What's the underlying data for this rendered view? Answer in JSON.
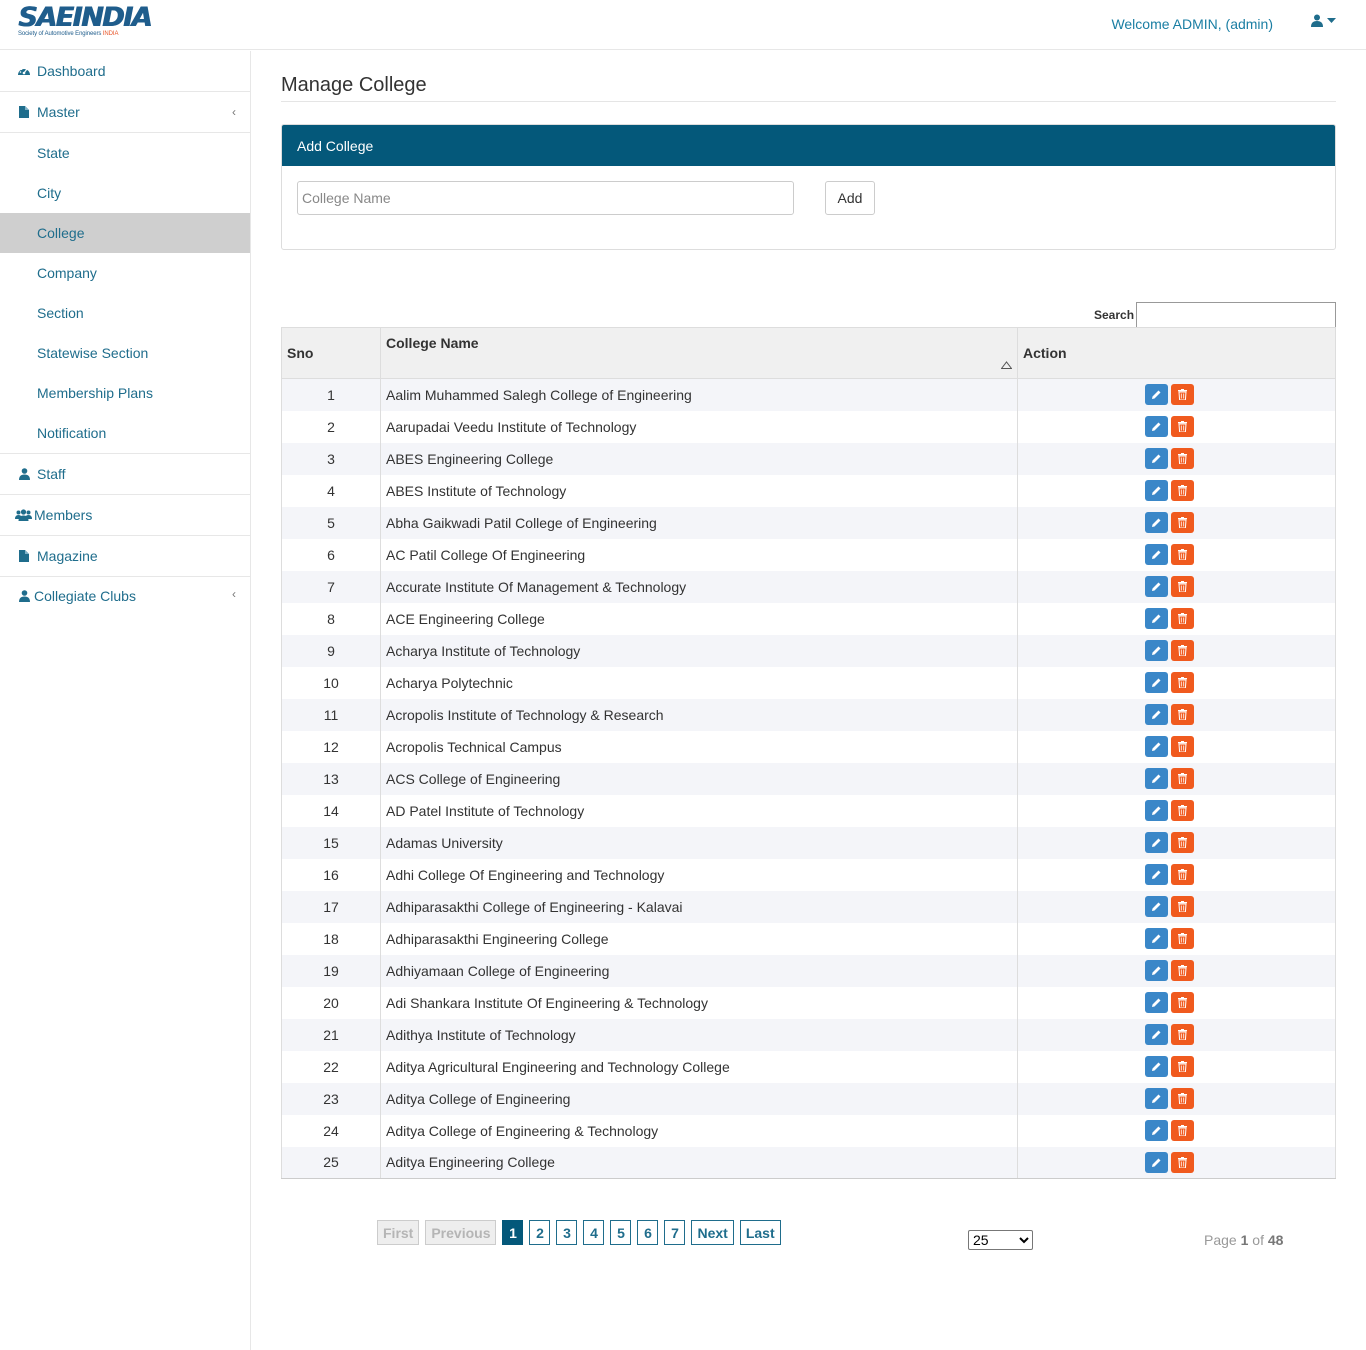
{
  "header": {
    "logo_text": "SAEINDIA",
    "logo_sub_prefix": "Society of Automotive Engineers ",
    "logo_sub_accent": "INDIA",
    "welcome": "Welcome ADMIN, (admin)"
  },
  "sidebar": {
    "dashboard": "Dashboard",
    "master": "Master",
    "master_items": [
      "State",
      "City",
      "College",
      "Company",
      "Section",
      "Statewise Section",
      "Membership Plans",
      "Notification"
    ],
    "active_item": "College",
    "staff": "Staff",
    "members": "Members",
    "magazine": "Magazine",
    "collegiate_clubs": "Collegiate Clubs"
  },
  "main": {
    "title": "Manage College",
    "panel_title": "Add College",
    "name_placeholder": "College Name",
    "add_label": "Add",
    "search_label": "Search",
    "columns": {
      "sno": "Sno",
      "name": "College Name",
      "action": "Action"
    },
    "rows": [
      {
        "sno": "1",
        "name": "Aalim Muhammed Salegh College of Engineering"
      },
      {
        "sno": "2",
        "name": "Aarupadai Veedu Institute of Technology"
      },
      {
        "sno": "3",
        "name": "ABES Engineering College"
      },
      {
        "sno": "4",
        "name": "ABES Institute of Technology"
      },
      {
        "sno": "5",
        "name": "Abha Gaikwadi Patil College of Engineering"
      },
      {
        "sno": "6",
        "name": "AC Patil College Of Engineering"
      },
      {
        "sno": "7",
        "name": "Accurate Institute Of Management & Technology"
      },
      {
        "sno": "8",
        "name": "ACE Engineering College"
      },
      {
        "sno": "9",
        "name": "Acharya Institute of Technology"
      },
      {
        "sno": "10",
        "name": "Acharya Polytechnic"
      },
      {
        "sno": "11",
        "name": "Acropolis Institute of Technology & Research"
      },
      {
        "sno": "12",
        "name": "Acropolis Technical Campus"
      },
      {
        "sno": "13",
        "name": "ACS College of Engineering"
      },
      {
        "sno": "14",
        "name": "AD Patel Institute of Technology"
      },
      {
        "sno": "15",
        "name": "Adamas University"
      },
      {
        "sno": "16",
        "name": "Adhi College Of Engineering and Technology"
      },
      {
        "sno": "17",
        "name": "Adhiparasakthi College of Engineering - Kalavai"
      },
      {
        "sno": "18",
        "name": "Adhiparasakthi Engineering College"
      },
      {
        "sno": "19",
        "name": "Adhiyamaan College of Engineering"
      },
      {
        "sno": "20",
        "name": "Adi Shankara Institute Of Engineering & Technology"
      },
      {
        "sno": "21",
        "name": "Adithya Institute of Technology"
      },
      {
        "sno": "22",
        "name": "Aditya Agricultural Engineering and Technology College"
      },
      {
        "sno": "23",
        "name": "Aditya College of Engineering"
      },
      {
        "sno": "24",
        "name": "Aditya College of Engineering & Technology"
      },
      {
        "sno": "25",
        "name": "Aditya Engineering College"
      }
    ],
    "pagination": {
      "first": "First",
      "previous": "Previous",
      "pages": [
        "1",
        "2",
        "3",
        "4",
        "5",
        "6",
        "7"
      ],
      "current": "1",
      "next": "Next",
      "last": "Last",
      "per_page": "25",
      "info_prefix": "Page",
      "info_current": "1",
      "info_of": "of",
      "info_total": "48"
    }
  },
  "colors": {
    "accent": "#04587a",
    "link": "#1f6d8c",
    "edit": "#3a87c8",
    "delete": "#f05a1e"
  },
  "icons": [
    "tachometer-icon",
    "file-icon",
    "user-icon",
    "users-icon",
    "pencil-icon",
    "trash-icon",
    "caret-down-icon",
    "chevron-left-icon",
    "sort-asc-icon"
  ]
}
